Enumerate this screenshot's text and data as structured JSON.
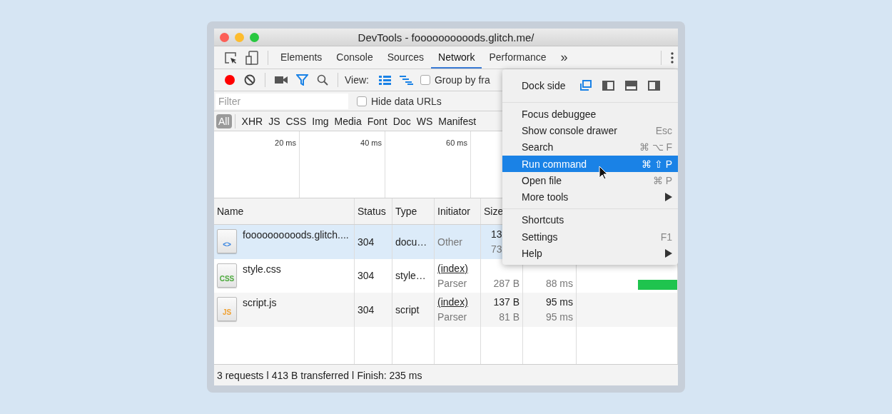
{
  "window": {
    "title": "DevTools - foooooooooods.glitch.me/"
  },
  "tabs": [
    {
      "label": "Elements",
      "selected": false
    },
    {
      "label": "Console",
      "selected": false
    },
    {
      "label": "Sources",
      "selected": false
    },
    {
      "label": "Network",
      "selected": true
    },
    {
      "label": "Performance",
      "selected": false
    }
  ],
  "more_tabs": "»",
  "toolbar": {
    "recording": true,
    "view_label": "View:",
    "large_rows": true,
    "group_by_frames": {
      "label": "Group by fra",
      "checked": false
    }
  },
  "filter": {
    "placeholder": "Filter",
    "hide_data_urls": {
      "label": "Hide data URLs",
      "checked": false
    }
  },
  "type_filters": [
    {
      "label": "All",
      "selected": true
    },
    {
      "label": "XHR",
      "selected": false
    },
    {
      "label": "JS",
      "selected": false
    },
    {
      "label": "CSS",
      "selected": false
    },
    {
      "label": "Img",
      "selected": false
    },
    {
      "label": "Media",
      "selected": false
    },
    {
      "label": "Font",
      "selected": false
    },
    {
      "label": "Doc",
      "selected": false
    },
    {
      "label": "WS",
      "selected": false
    },
    {
      "label": "Manifest",
      "selected": false
    }
  ],
  "overview_ticks": [
    "20 ms",
    "40 ms",
    "60 ms"
  ],
  "table": {
    "columns": [
      "Name",
      "Status",
      "Type",
      "Initiator",
      "Size"
    ],
    "rows": [
      {
        "badge": "<>",
        "color": "#2f7fe0",
        "name": "foooooooooods.glitch....",
        "status": "304",
        "type": "docu…",
        "initiator": "Other",
        "initiator_link": false,
        "size": "13",
        "size_detail": "73",
        "cut_by_menu": true,
        "selected": true,
        "waterfall_bar": false
      },
      {
        "badge": "CSS",
        "color": "#4caa3c",
        "name": "style.css",
        "status": "304",
        "type": "style…",
        "initiator": "(index)",
        "initiator_link": true,
        "initiator_detail": "Parser",
        "size_detail": "287 B",
        "time_detail": "88 ms",
        "cut_by_menu": false,
        "selected": false,
        "waterfall_bar": true
      },
      {
        "badge": "JS",
        "color": "#f0a030",
        "name": "script.js",
        "status": "304",
        "type": "script",
        "initiator": "(index)",
        "initiator_link": true,
        "initiator_detail": "Parser",
        "size": "137 B",
        "size_detail": "81 B",
        "time": "95 ms",
        "time_detail": "95 ms",
        "cut_by_menu": false,
        "selected": false,
        "waterfall_bar": false
      }
    ]
  },
  "status_bar": "3 requests ǀ 413 B transferred ǀ Finish: 235 ms",
  "menu": {
    "dock_side": {
      "label": "Dock side",
      "options": [
        {
          "kind": "undock",
          "selected": true
        },
        {
          "kind": "left",
          "selected": false
        },
        {
          "kind": "bottom",
          "selected": false
        },
        {
          "kind": "right",
          "selected": false
        }
      ]
    },
    "sections": [
      [
        {
          "label": "Focus debuggee",
          "submenu": false,
          "selected": false
        },
        {
          "label": "Show console drawer",
          "shortcut": "Esc",
          "submenu": false,
          "selected": false
        },
        {
          "label": "Search",
          "shortcut": "⌘ ⌥ F",
          "submenu": false,
          "selected": false
        },
        {
          "label": "Run command",
          "shortcut": "⌘ ⇧ P",
          "submenu": false,
          "selected": true
        },
        {
          "label": "Open file",
          "shortcut": "⌘ P",
          "submenu": false,
          "selected": false
        },
        {
          "label": "More tools",
          "submenu": true,
          "selected": false
        }
      ],
      [
        {
          "label": "Shortcuts",
          "submenu": false,
          "selected": false
        },
        {
          "label": "Settings",
          "shortcut": "F1",
          "submenu": false,
          "selected": false
        },
        {
          "label": "Help",
          "submenu": true,
          "selected": false
        }
      ]
    ]
  }
}
